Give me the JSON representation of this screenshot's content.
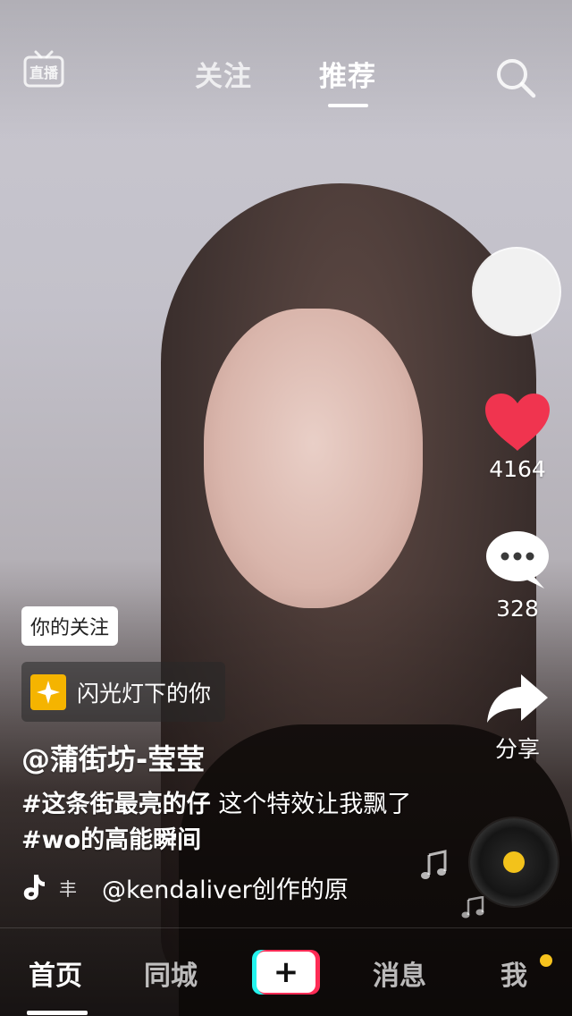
{
  "top_bar": {
    "live_icon_label": "直播",
    "tabs": [
      {
        "label": "关注",
        "active": false
      },
      {
        "label": "推荐",
        "active": true
      }
    ],
    "search_icon": "search-icon"
  },
  "right_rail": {
    "like_count": "4164",
    "comment_count": "328",
    "share_label": "分享",
    "like_color": "#f0344f"
  },
  "video_info": {
    "follow_tag": "你的关注",
    "effect_label": "闪光灯下的你",
    "username": "@蒲街坊-莹莹",
    "caption_tag1": "#这条街最亮的仔",
    "caption_text1": " 这个特效让我飘了",
    "caption_tag2": "#wo的高能瞬间",
    "music_fade_text": "丰",
    "music_text": "@kendaliver创作的原"
  },
  "bottom_nav": {
    "items": [
      "首页",
      "同城",
      "消息",
      "我"
    ],
    "create_label": "+",
    "active": "首页",
    "notification_dot_color": "#f6c21d"
  }
}
